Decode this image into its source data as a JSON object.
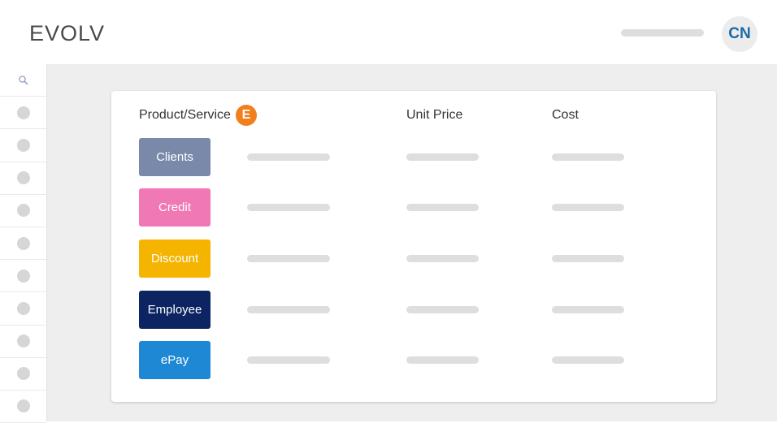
{
  "header": {
    "brand": "EVOLV",
    "avatar_initials": "CN"
  },
  "sidebar": {
    "search_icon": "search-icon",
    "item_count": 10
  },
  "table": {
    "columns": {
      "product": "Product/Service",
      "unit_price": "Unit Price",
      "cost": "Cost"
    },
    "product_badge": "E",
    "rows": [
      {
        "label": "Clients",
        "color": "#7a89aa"
      },
      {
        "label": "Credit",
        "color": "#ef78b5"
      },
      {
        "label": "Discount",
        "color": "#f4b400"
      },
      {
        "label": "Employee",
        "color": "#0c2461"
      },
      {
        "label": "ePay",
        "color": "#1e88d5"
      }
    ]
  },
  "colors": {
    "badge": "#f07f1c",
    "avatar_text": "#1a6aa8",
    "placeholder": "#dedede",
    "background": "#eeeeee"
  }
}
